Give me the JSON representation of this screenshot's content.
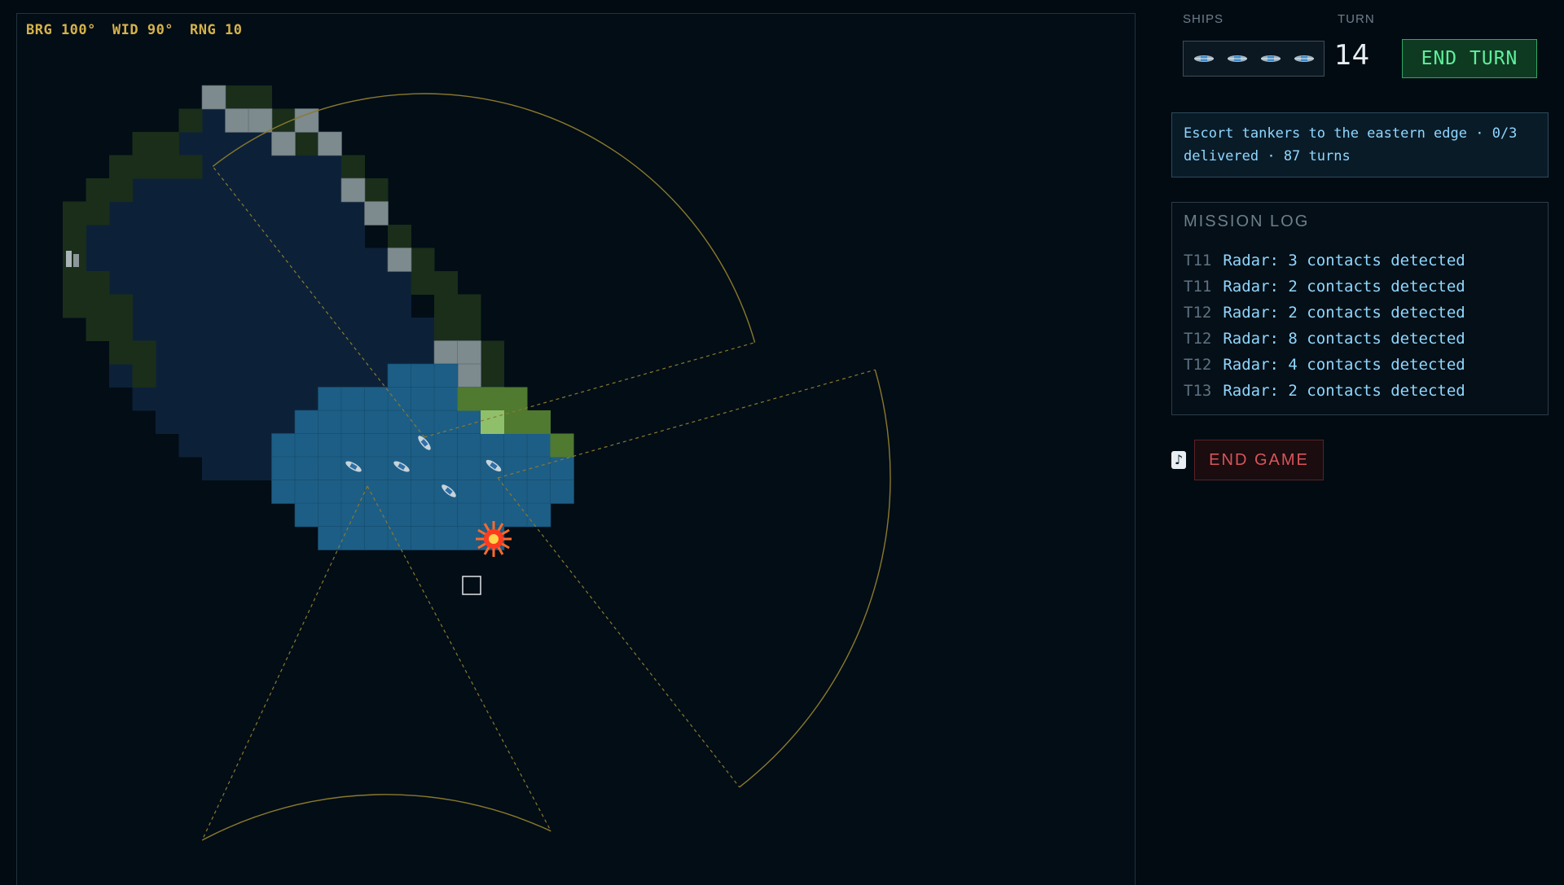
{
  "hud": {
    "bearing": "BRG 100°",
    "width": "WID 90°",
    "range": "RNG 10"
  },
  "sidebar": {
    "ships_label": "SHIPS",
    "turn_label": "TURN",
    "turn": "14",
    "ships": [
      {
        "icon": "ship-icon"
      },
      {
        "icon": "ship-icon"
      },
      {
        "icon": "ship-icon"
      },
      {
        "icon": "ship-icon"
      }
    ],
    "end_turn_label": "END TURN",
    "objective": "Escort tankers to the eastern edge · 0/3 delivered · 87 turns",
    "log_title": "MISSION LOG",
    "log": [
      {
        "turn": "T11",
        "message": "Radar: 3 contacts detected"
      },
      {
        "turn": "T11",
        "message": "Radar: 2 contacts detected"
      },
      {
        "turn": "T12",
        "message": "Radar: 2 contacts detected"
      },
      {
        "turn": "T12",
        "message": "Radar: 8 contacts detected"
      },
      {
        "turn": "T12",
        "message": "Radar: 4 contacts detected"
      },
      {
        "turn": "T13",
        "message": "Radar: 2 contacts detected"
      }
    ],
    "music_icon": "music-note-icon",
    "end_game_label": "END GAME"
  },
  "colors": {
    "background": "#030b12",
    "deep_water": "#0c2138",
    "shallow_water": "#1d5e86",
    "forest": "#1a2e1a",
    "grass": "#4f7a30",
    "rock": "#7d8a8e",
    "radar_arc": "#8a7a2c",
    "hud_text": "#d6b24a",
    "end_turn": "#5ff09c",
    "end_game": "#d8545a"
  }
}
